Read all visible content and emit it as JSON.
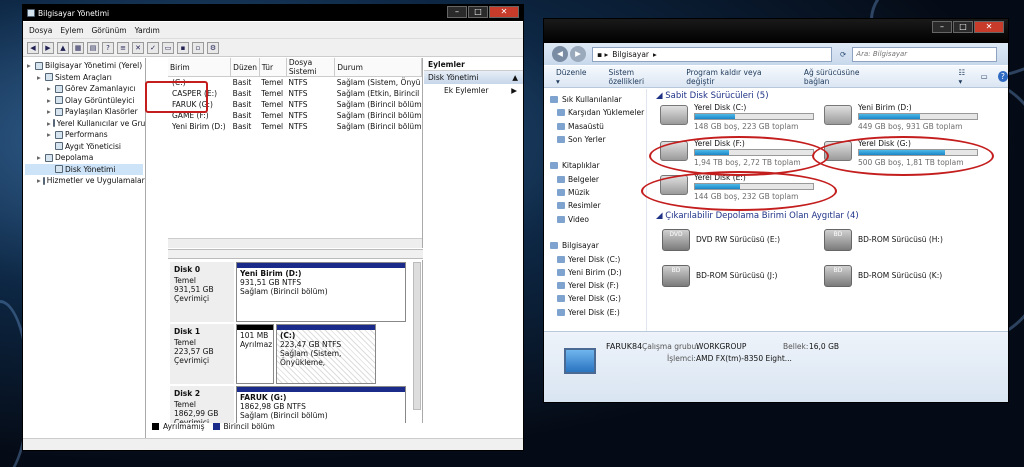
{
  "left_window": {
    "title": "Bilgisayar Yönetimi",
    "menu": [
      "Dosya",
      "Eylem",
      "Görünüm",
      "Yardım"
    ],
    "tree": [
      {
        "label": "Bilgisayar Yönetimi (Yerel)",
        "level": 0
      },
      {
        "label": "Sistem Araçları",
        "level": 1
      },
      {
        "label": "Görev Zamanlayıcı",
        "level": 2
      },
      {
        "label": "Olay Görüntüleyici",
        "level": 2
      },
      {
        "label": "Paylaşılan Klasörler",
        "level": 2
      },
      {
        "label": "Yerel Kullanıcılar ve Gru",
        "level": 2
      },
      {
        "label": "Performans",
        "level": 2
      },
      {
        "label": "Aygıt Yöneticisi",
        "level": 2
      },
      {
        "label": "Depolama",
        "level": 1
      },
      {
        "label": "Disk Yönetimi",
        "level": 2
      },
      {
        "label": "Hizmetler ve Uygulamalar",
        "level": 1
      }
    ],
    "columns": [
      "Birim",
      "Düzen",
      "Tür",
      "Dosya Sistemi",
      "Durum"
    ],
    "rows": [
      [
        "(C:)",
        "Basit",
        "Temel",
        "NTFS",
        "Sağlam (Sistem, Önyü"
      ],
      [
        "CASPER (E:)",
        "Basit",
        "Temel",
        "NTFS",
        "Sağlam (Etkin, Birincil"
      ],
      [
        "FARUK (G:)",
        "Basit",
        "Temel",
        "NTFS",
        "Sağlam (Birincil bölüm"
      ],
      [
        "GAME (F:)",
        "Basit",
        "Temel",
        "NTFS",
        "Sağlam (Birincil bölüm"
      ],
      [
        "Yeni Birim (D:)",
        "Basit",
        "Temel",
        "NTFS",
        "Sağlam (Birincil bölüm"
      ]
    ],
    "disks": [
      {
        "name": "Disk 0",
        "type": "Temel",
        "size": "931,51 GB",
        "state": "Çevrimiçi",
        "parts": [
          {
            "name": "Yeni Birim  (D:)",
            "size": "931,51 GB NTFS",
            "status": "Sağlam (Birincil bölüm)"
          }
        ]
      },
      {
        "name": "Disk 1",
        "type": "Temel",
        "size": "223,57 GB",
        "state": "Çevrimiçi",
        "parts": [
          {
            "name": "",
            "size": "101 MB",
            "status": "Ayrılmaz"
          },
          {
            "name": "(C:)",
            "size": "223,47 GB NTFS",
            "status": "Sağlam (Sistem, Önyükleme,"
          }
        ]
      },
      {
        "name": "Disk 2",
        "type": "Temel",
        "size": "1862,99 GB",
        "state": "Çevrimiçi",
        "parts": [
          {
            "name": "FARUK  (G:)",
            "size": "1862,98 GB NTFS",
            "status": "Sağlam (Birincil bölüm)"
          }
        ]
      }
    ],
    "legend": [
      "Ayrılmamış",
      "Birincil bölüm"
    ],
    "actions": {
      "header": "Eylemler",
      "selected": "Disk Yönetimi",
      "more": "Ek Eylemler"
    }
  },
  "right_window": {
    "breadcrumb": "Bilgisayar",
    "search_placeholder": "Ara: Bilgisayar",
    "commands": [
      "Düzenle",
      "Sistem özellikleri",
      "Program kaldır veya değiştir",
      "Ağ sürücüsüne bağlan"
    ],
    "nav": [
      {
        "label": "Sık Kullanılanlar",
        "group": true
      },
      {
        "label": "Karşıdan Yüklemeler",
        "group": false
      },
      {
        "label": "Masaüstü",
        "group": false
      },
      {
        "label": "Son Yerler",
        "group": false
      },
      {
        "label": "",
        "group": false
      },
      {
        "label": "Kitaplıklar",
        "group": true
      },
      {
        "label": "Belgeler",
        "group": false
      },
      {
        "label": "Müzik",
        "group": false
      },
      {
        "label": "Resimler",
        "group": false
      },
      {
        "label": "Video",
        "group": false
      },
      {
        "label": "",
        "group": false
      },
      {
        "label": "Bilgisayar",
        "group": true
      },
      {
        "label": "Yerel Disk (C:)",
        "group": false
      },
      {
        "label": "Yeni Birim (D:)",
        "group": false
      },
      {
        "label": "Yerel Disk (F:)",
        "group": false
      },
      {
        "label": "Yerel Disk (G:)",
        "group": false
      },
      {
        "label": "Yerel Disk (E:)",
        "group": false
      },
      {
        "label": "",
        "group": false
      },
      {
        "label": "Ağ",
        "group": true
      }
    ],
    "hdd_group": "Sabit Disk Sürücüleri (5)",
    "drives": [
      {
        "name": "Yerel Disk (C:)",
        "free": "148 GB boş, 223 GB toplam",
        "used": 0.34
      },
      {
        "name": "Yeni Birim (D:)",
        "free": "449 GB boş, 931 GB toplam",
        "used": 0.52
      },
      {
        "name": "Yerel Disk (F:)",
        "free": "1,94 TB boş, 2,72 TB toplam",
        "used": 0.29
      },
      {
        "name": "Yerel Disk (G:)",
        "free": "500 GB boş, 1,81 TB toplam",
        "used": 0.73
      },
      {
        "name": "Yerel Disk (E:)",
        "free": "144 GB boş, 232 GB toplam",
        "used": 0.38
      }
    ],
    "rem_group": "Çıkarılabilir Depolama Birimi Olan Aygıtlar (4)",
    "removable": [
      {
        "name": "DVD RW Sürücüsü (E:)",
        "tag": "DVD"
      },
      {
        "name": "BD-ROM Sürücüsü (H:)",
        "tag": "BD"
      },
      {
        "name": "BD-ROM Sürücüsü (J:)",
        "tag": "BD"
      },
      {
        "name": "BD-ROM Sürücüsü (K:)",
        "tag": "BD"
      }
    ],
    "details": {
      "name": "FARUK84",
      "wg_label": "Çalışma grubu:",
      "wg": "WORKGROUP",
      "mem_label": "Bellek:",
      "mem": "16,0 GB",
      "cpu_label": "İşlemci:",
      "cpu": "AMD FX(tm)-8350 Eight..."
    }
  }
}
